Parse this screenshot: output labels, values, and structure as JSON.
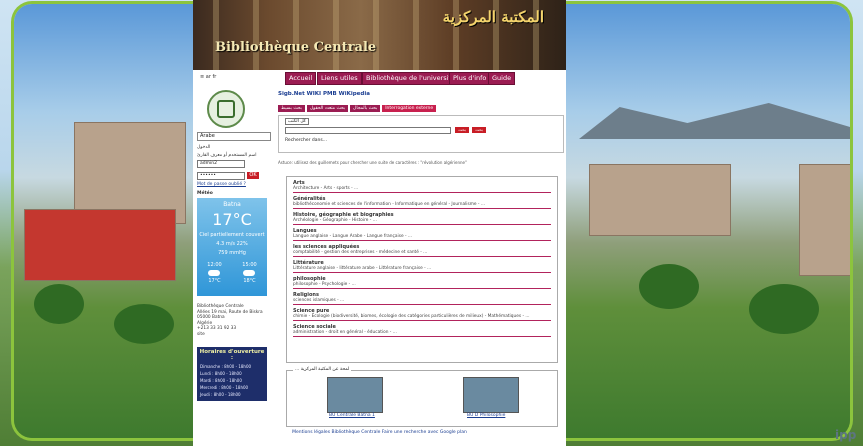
{
  "banner": {
    "title_ar": "المكتبة المركزية",
    "title_fr": "Bibliothèque Centrale"
  },
  "topbar": {
    "lang": "≡ ar fr",
    "nav": [
      "Accueil",
      "Liens utiles",
      "Bibliothèque de l'université",
      "Plus d'info",
      "Guide"
    ]
  },
  "sidebar": {
    "language": "Arabe",
    "login_label": "الدخول",
    "username_label": "اسم المستخدم أو معرف القارئ",
    "username_value": "admin2",
    "password_value": "••••••",
    "ok_label": "OK",
    "forgot": "Mot de passe oublié ?",
    "meteo_label": "Météo",
    "weather": {
      "city": "Batna",
      "temp": "17°C",
      "cond": "Ciel partiellement couvert",
      "wind": "4.3 m/s",
      "humidity": "22%",
      "pressure": "759 mmHg",
      "f1_time": "12:00",
      "f1_temp": "17°C",
      "f2_time": "15:00",
      "f2_temp": "18°C"
    },
    "address": "Bibliothèque Centrale\nAllées 19 mai, Route de Biskra\n05000 Batna\nAlgérie\n+213 33 31 92 33\nsite",
    "hours_title": "Horaires d'ouverture :",
    "hours": [
      "Dimanche : 8h00 - 18h00",
      "Lundi : 8h00 - 18h00",
      "Mardi : 8h00 - 18h00",
      "Mercredi : 8h00 - 18h00",
      "Jeudi : 8h00 - 18h00"
    ]
  },
  "links": "Sigb.Net WIKI PMB WiKipedia",
  "search": {
    "tabs": [
      "بحث بسيط",
      "بحث متعدد الحقول",
      "بحث بالمجال",
      "Interrogation externe"
    ],
    "scope": "كل الكتب",
    "btn1": "بحث",
    "btn2": "بحث متقدم",
    "refine": "Rechercher dans..."
  },
  "hint": "Astuce: utilisez des guillemets pour chercher une suite de caractères : \"révolution algérienne\"",
  "cats": [
    {
      "t": "Arts",
      "s": "Architecture - Arts - sports - ..."
    },
    {
      "t": "Généralités",
      "s": "bibliothéconomie et sciences de l'information - Informatique en général - Journalisme - ..."
    },
    {
      "t": "Histoire, géographie et biographies",
      "s": "Archéologie - Géographie - Histoire - ..."
    },
    {
      "t": "Langues",
      "s": "Langue anglaise - Langue Arabe - Langue française - ..."
    },
    {
      "t": "les sciences appliquées",
      "s": "comptabilité - gestion des entreprises - médecine et santé - ..."
    },
    {
      "t": "Littérature",
      "s": "Littérature anglaise - littérature arabe - Littérature française - ..."
    },
    {
      "t": "philosophie",
      "s": "philosophie - Psychologie - ..."
    },
    {
      "t": "Religions",
      "s": "sciences islamiques - ..."
    },
    {
      "t": "Science pure",
      "s": "chimie - Écologie (biodiversité, biomes, écologie des catégories particulières de milieux) - Mathématiques - ..."
    },
    {
      "t": "Science sociale",
      "s": "administration - droit en général - éducation - ..."
    }
  ],
  "gallery": {
    "title": "... لمحة عن المكتبة المركزية",
    "cap1": "BU Centrale Batna 1",
    "cap2": "BU D Philosophie"
  },
  "footer": "Mentions légales  Bibliothèque Centrale  Faire une recherche avec Google  plan",
  "watermark": "ipp"
}
